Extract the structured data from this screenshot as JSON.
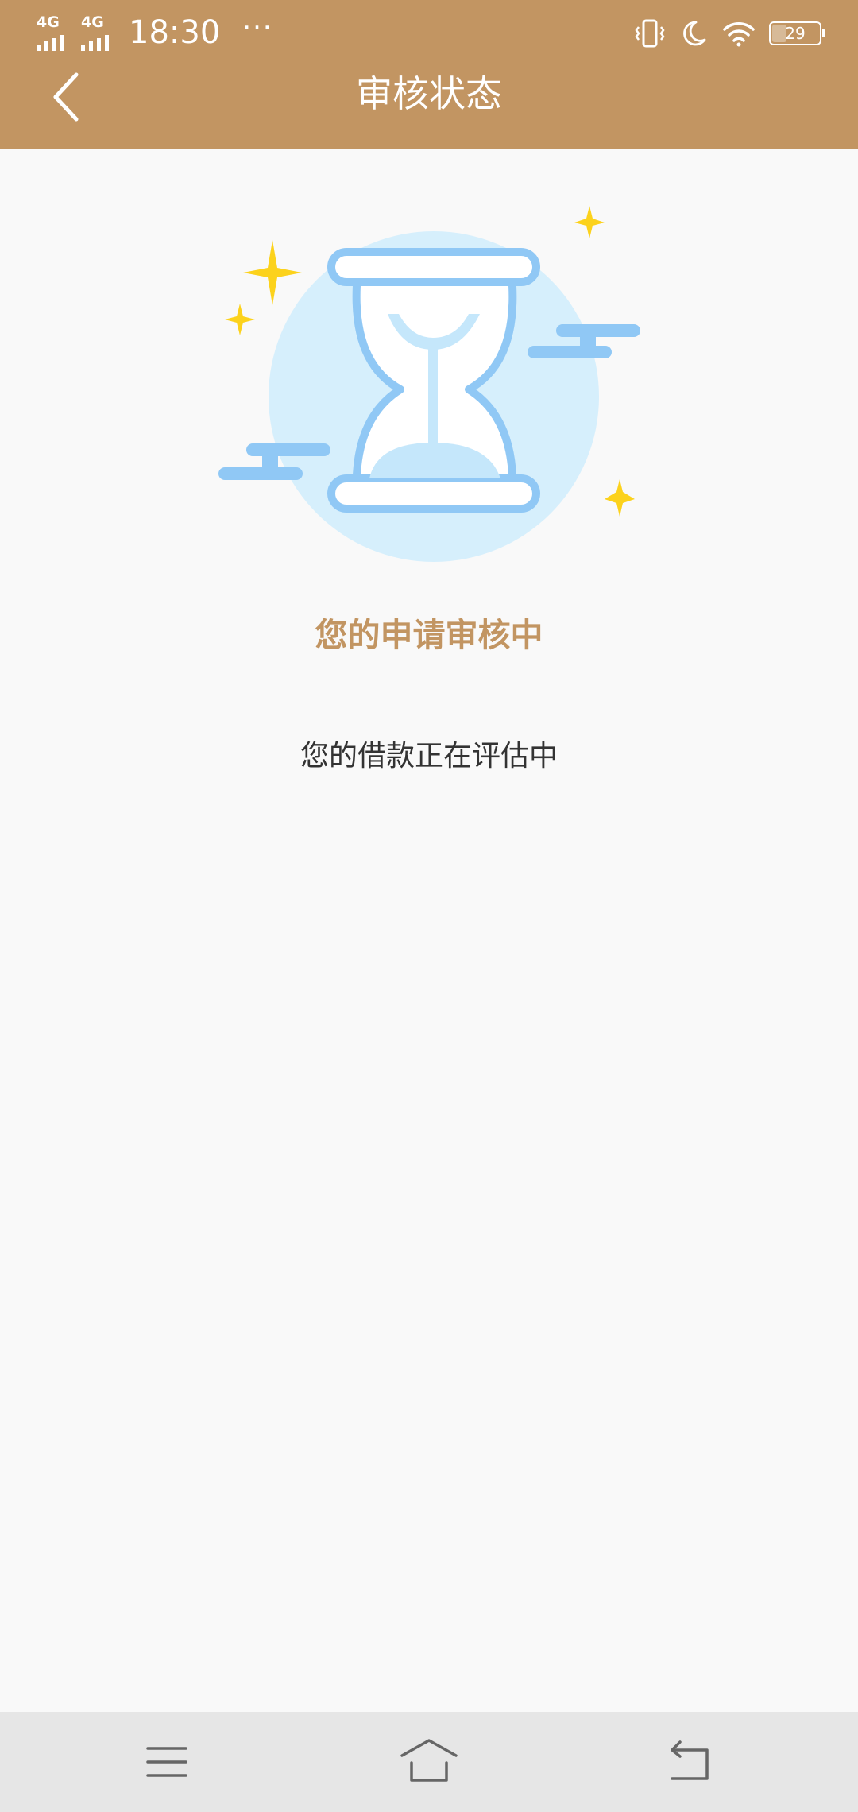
{
  "status_bar": {
    "network_1": "4G",
    "network_2": "4G",
    "time": "18:30",
    "more": "···",
    "battery_level": "29",
    "icons": [
      "vibrate-icon",
      "moon-icon",
      "wifi-icon",
      "battery-icon"
    ]
  },
  "header": {
    "title": "审核状态",
    "back_icon": "chevron-left-icon"
  },
  "content": {
    "illustration": "hourglass-icon",
    "status_title": "您的申请审核中",
    "status_desc": "您的借款正在评估中"
  },
  "nav_bar": {
    "icons": [
      "menu-icon",
      "home-icon",
      "back-icon"
    ]
  },
  "colors": {
    "header_bg": "#c29562",
    "accent": "#c29562",
    "page_bg": "#f9f9f9",
    "nav_bg": "#e6e6e6",
    "hourglass_blue": "#90c8f5",
    "circle_blue": "#d6effc",
    "star_yellow": "#fcd21c"
  }
}
